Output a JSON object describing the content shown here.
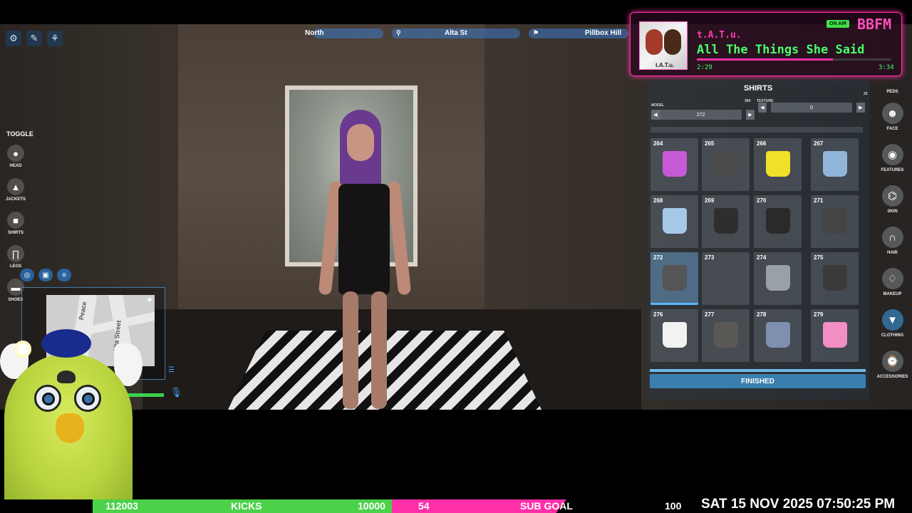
{
  "street": {
    "direction": "North",
    "street": "Alta St",
    "zone": "Pillbox Hill"
  },
  "toolbar": {
    "icons": [
      "gear-icon",
      "wand-icon",
      "pose-icon"
    ]
  },
  "toggle": {
    "title": "TOGGLE",
    "items": [
      {
        "label": "HEAD",
        "icon": "head-icon"
      },
      {
        "label": "JACKETS",
        "icon": "jacket-icon"
      },
      {
        "label": "SHIRTS",
        "icon": "shirt-icon"
      },
      {
        "label": "LEGS",
        "icon": "legs-icon"
      },
      {
        "label": "SHOES",
        "icon": "shoe-icon"
      }
    ]
  },
  "minimap": {
    "labels": [
      "Peace",
      "Alta Street"
    ]
  },
  "music": {
    "artist": "t.A.T.u.",
    "song": "All The Things She Said",
    "on_air": "ON AIR",
    "station": "BBFM",
    "album_text": "t.A.T.u.",
    "elapsed": "2:29",
    "total": "3:34",
    "progress": 0.7,
    "accent": "#ff2fa8",
    "text_color": "#48ff6a"
  },
  "panel": {
    "title": "SHIRTS",
    "model_label": "MODEL",
    "model_max": "394",
    "model_value": "272",
    "texture_label": "TEXTURE",
    "texture_max": "25",
    "texture_value": "0",
    "items": [
      {
        "num": "264",
        "color": "#c65ad6"
      },
      {
        "num": "265",
        "color": "#4a4a48"
      },
      {
        "num": "266",
        "color": "#f0e02a"
      },
      {
        "num": "267",
        "color": "#8fb6d8"
      },
      {
        "num": "268",
        "color": "#a6c8e8"
      },
      {
        "num": "269",
        "color": "#2e2e2e"
      },
      {
        "num": "270",
        "color": "#2a2a2a"
      },
      {
        "num": "271",
        "color": "#444444"
      },
      {
        "num": "272",
        "color": "#555555"
      },
      {
        "num": "273",
        "color": ""
      },
      {
        "num": "274",
        "color": "#9aa0a8"
      },
      {
        "num": "275",
        "color": "#3a3a38"
      },
      {
        "num": "276",
        "color": "#f2f2f2"
      },
      {
        "num": "277",
        "color": "#5a5854"
      },
      {
        "num": "278",
        "color": "#7e8fb0"
      },
      {
        "num": "279",
        "color": "#f28ec4"
      }
    ],
    "selected_index": 8,
    "finished": "FINISHED"
  },
  "sidebar": {
    "items": [
      {
        "label": "PEDS",
        "icon": "ped-icon"
      },
      {
        "label": "FACE",
        "icon": "face-icon"
      },
      {
        "label": "FEATURES",
        "icon": "eye-icon"
      },
      {
        "label": "SKIN",
        "icon": "dna-icon"
      },
      {
        "label": "HAIR",
        "icon": "hair-icon"
      },
      {
        "label": "MAKEUP",
        "icon": "makeup-icon"
      },
      {
        "label": "CLOTHING",
        "icon": "tshirt-icon"
      },
      {
        "label": "ACCESSORIES",
        "icon": "watch-icon"
      }
    ],
    "active_index": 6
  },
  "ticker": {
    "count": "112003",
    "kicks": "KICKS",
    "goal_value": "10000",
    "subs": "54",
    "sub_goal": "SUB GOAL",
    "sub_target": "100",
    "clock": "SAT 15 NOV 2025 07:50:25 PM"
  }
}
